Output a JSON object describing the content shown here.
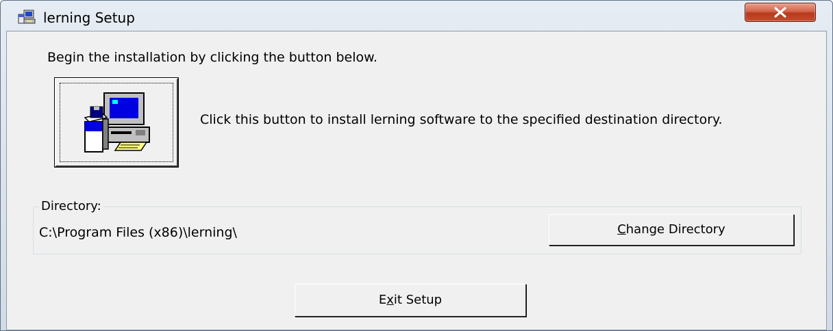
{
  "window": {
    "title": "lerning Setup",
    "app_icon": "setup-computer-icon",
    "close_icon": "close-icon"
  },
  "main": {
    "intro_text": "Begin the installation by clicking the button below.",
    "install_button_icon": "install-computer-icon",
    "install_description": "Click this button to install lerning software to the specified destination directory."
  },
  "directory": {
    "group_label": "Directory:",
    "path": "C:\\Program Files (x86)\\lerning\\",
    "change_button": {
      "mnemonic": "C",
      "rest": "hange Directory"
    }
  },
  "exit_button": {
    "before": "E",
    "mnemonic": "x",
    "after": "it Setup"
  },
  "colors": {
    "client_bg": "#f0f0f0",
    "close_button": "#c64b2c",
    "frame_border": "#5c6f86"
  }
}
